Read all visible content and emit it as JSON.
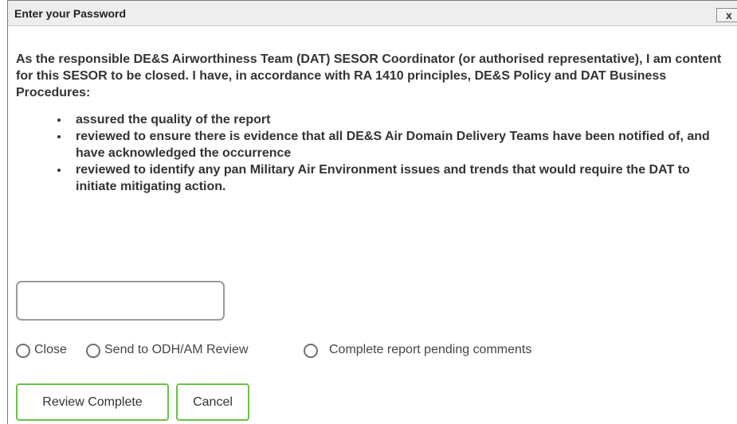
{
  "dialog": {
    "title": "Enter your Password",
    "close_label": "x"
  },
  "declaration": {
    "intro": "As the responsible DE&S Airworthiness Team (DAT) SESOR Coordinator (or authorised representative), I am content for this SESOR to be closed. I have, in accordance with RA 1410 principles, DE&S Policy and DAT Business Procedures:",
    "bullets": [
      "assured the quality of the report",
      "reviewed to ensure there is evidence that all DE&S Air Domain Delivery Teams have been notified of, and have acknowledged the occurrence",
      "reviewed to identify any pan Military Air Environment issues and trends that would require the DAT to initiate mitigating action."
    ]
  },
  "password": {
    "value": "",
    "placeholder": ""
  },
  "options": {
    "close": "Close",
    "send_review": "Send to ODH/AM Review",
    "complete_pending": "Complete report pending comments",
    "selected": "none"
  },
  "buttons": {
    "review_complete": "Review Complete",
    "cancel": "Cancel"
  },
  "colors": {
    "button_border": "#6cc04a",
    "titlebar_bg": "#eeeeee"
  }
}
